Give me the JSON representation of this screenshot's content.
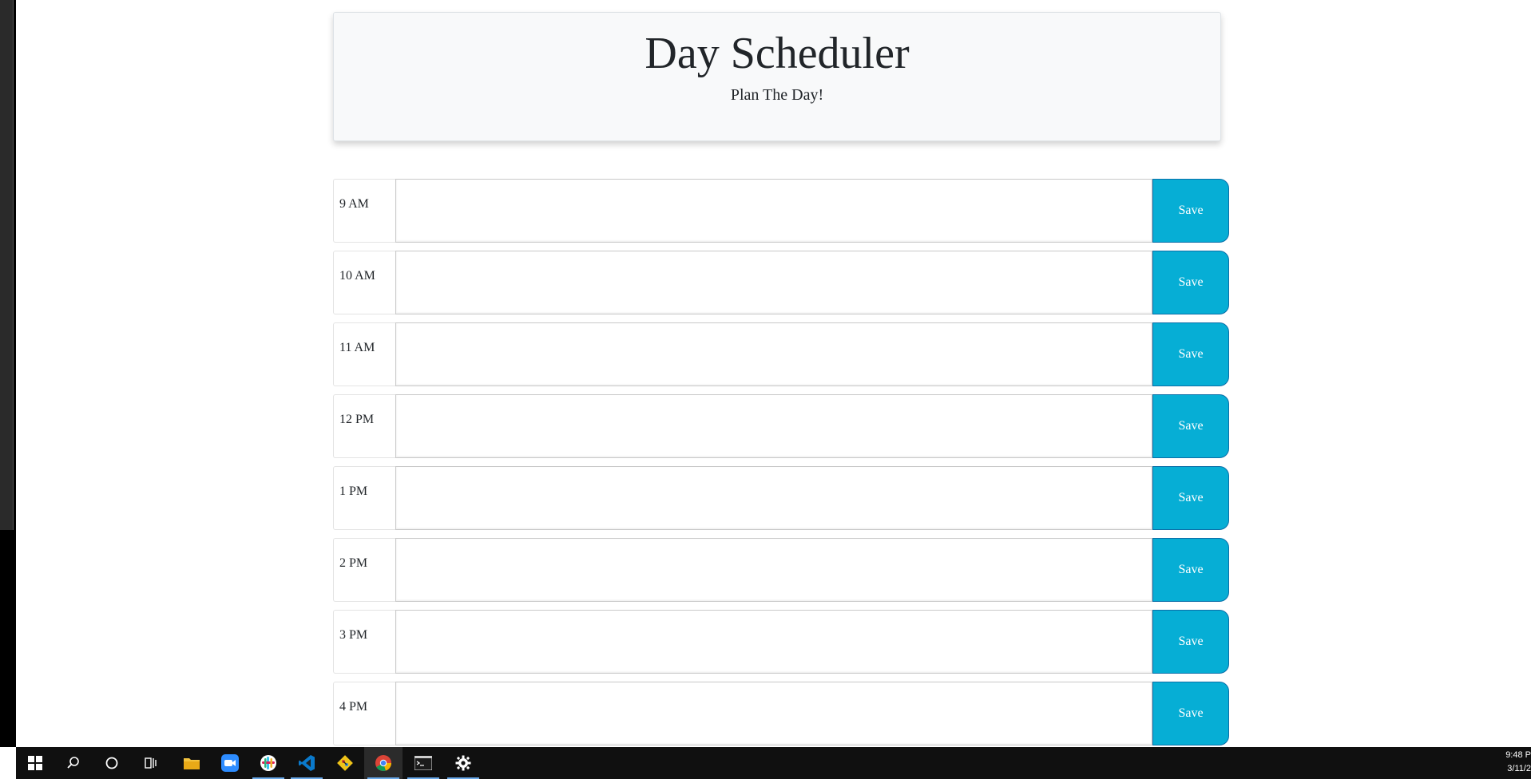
{
  "header": {
    "title": "Day Scheduler",
    "subtitle": "Plan The Day!"
  },
  "time_blocks": [
    {
      "hour": "9 AM",
      "task": "",
      "save_label": "Save"
    },
    {
      "hour": "10 AM",
      "task": "",
      "save_label": "Save"
    },
    {
      "hour": "11 AM",
      "task": "",
      "save_label": "Save"
    },
    {
      "hour": "12 PM",
      "task": "",
      "save_label": "Save"
    },
    {
      "hour": "1 PM",
      "task": "",
      "save_label": "Save"
    },
    {
      "hour": "2 PM",
      "task": "",
      "save_label": "Save"
    },
    {
      "hour": "3 PM",
      "task": "",
      "save_label": "Save"
    },
    {
      "hour": "4 PM",
      "task": "",
      "save_label": "Save"
    }
  ],
  "colors": {
    "save_button": "#06aed5",
    "header_bg": "#f8f9fa",
    "taskbar_bg": "#101010"
  },
  "taskbar": {
    "icons": [
      "windows-start-icon",
      "search-icon",
      "cortana-icon",
      "task-view-icon",
      "file-explorer-icon",
      "zoom-icon",
      "slack-icon",
      "vscode-icon",
      "git-icon",
      "chrome-icon",
      "terminal-icon",
      "settings-icon"
    ],
    "clock_time": "9:48 P",
    "clock_date": "3/11/2"
  }
}
